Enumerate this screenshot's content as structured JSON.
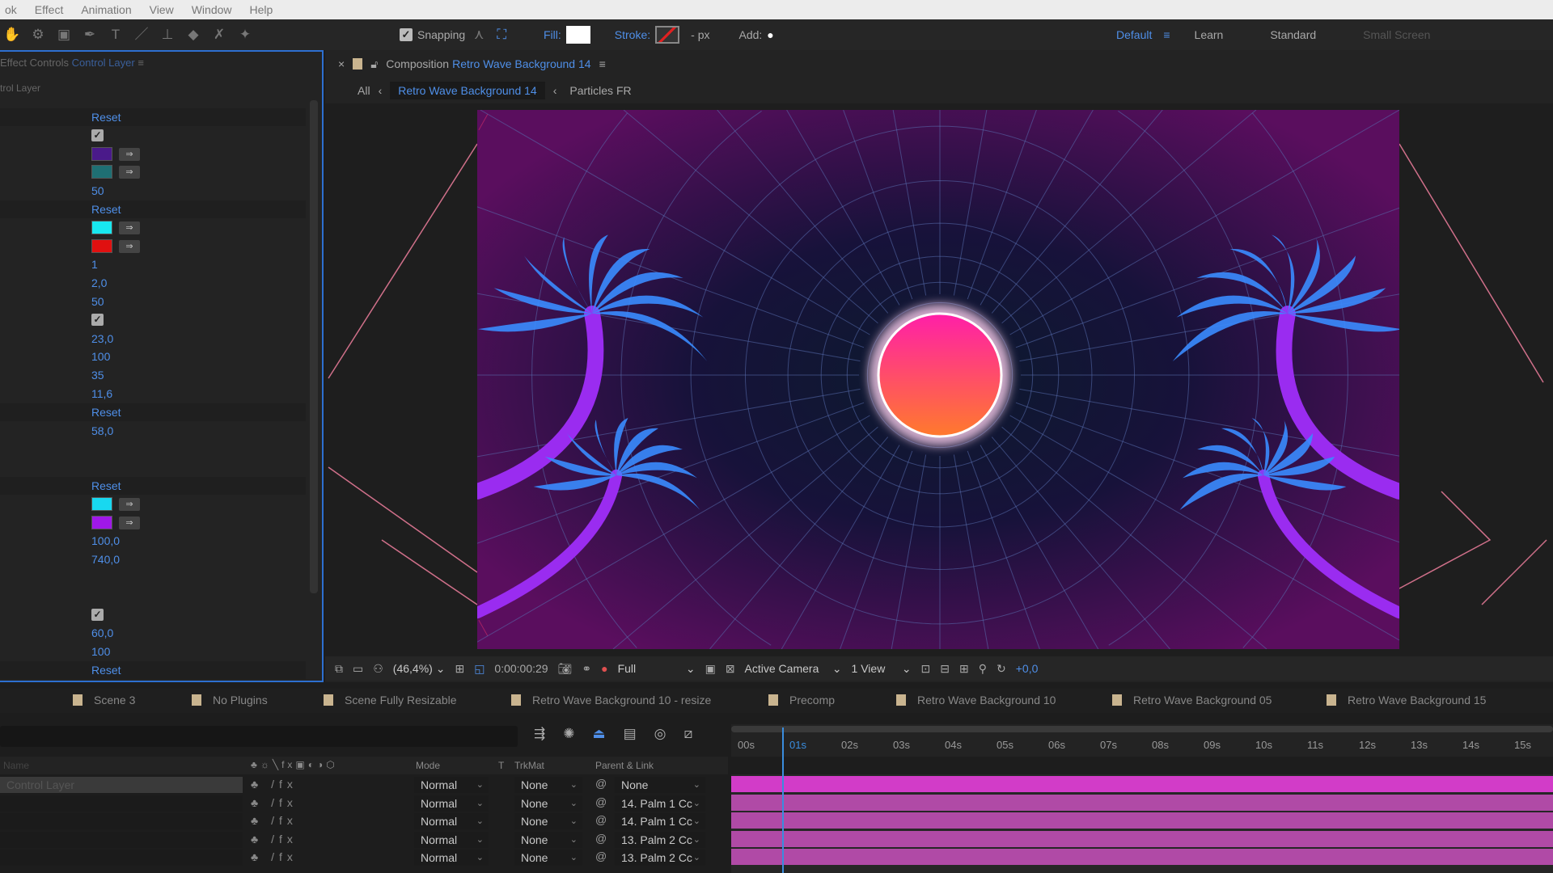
{
  "menu": [
    "ok",
    "Effect",
    "Animation",
    "View",
    "Window",
    "Help"
  ],
  "toolbar": {
    "snapping": "Snapping",
    "fill": "Fill:",
    "stroke": "Stroke:",
    "px": "- px",
    "add": "Add:",
    "workspaces": [
      "Default",
      "Learn",
      "Standard",
      "Small Screen"
    ],
    "fill_color": "#ffffff"
  },
  "left_panel": {
    "title": "Effect Controls",
    "layer": "Control Layer",
    "sublabel": "trol Layer",
    "rows": [
      {
        "t": "reset",
        "v": "Reset",
        "sec": true
      },
      {
        "t": "check"
      },
      {
        "t": "color",
        "c": "#4a1a8a"
      },
      {
        "t": "color",
        "c": "#1f6f73"
      },
      {
        "t": "val",
        "v": "50"
      },
      {
        "t": "reset",
        "v": "Reset",
        "sec": true
      },
      {
        "t": "color",
        "c": "#18e8f0"
      },
      {
        "t": "color",
        "c": "#e01010"
      },
      {
        "t": "val",
        "v": "1"
      },
      {
        "t": "val",
        "v": "2,0"
      },
      {
        "t": "val",
        "v": "50"
      },
      {
        "t": "check"
      },
      {
        "t": "val",
        "v": "23,0"
      },
      {
        "t": "val",
        "v": "100"
      },
      {
        "t": "val",
        "v": "35"
      },
      {
        "t": "val",
        "v": "11,6"
      },
      {
        "t": "reset",
        "v": "Reset",
        "sec": true
      },
      {
        "t": "val",
        "v": "58,0"
      },
      {
        "t": "gap"
      },
      {
        "t": "gap"
      },
      {
        "t": "reset",
        "v": "Reset",
        "sec": true
      },
      {
        "t": "color",
        "c": "#18d8f0"
      },
      {
        "t": "color",
        "c": "#a018e8"
      },
      {
        "t": "val",
        "v": "100,0"
      },
      {
        "t": "val",
        "v": "740,0"
      },
      {
        "t": "gap"
      },
      {
        "t": "gap"
      },
      {
        "t": "check"
      },
      {
        "t": "val",
        "v": "60,0"
      },
      {
        "t": "val",
        "v": "100"
      },
      {
        "t": "reset",
        "v": "Reset",
        "sec": true
      }
    ]
  },
  "composition": {
    "label": "Composition",
    "name": "Retro Wave Background 14",
    "tabs": {
      "all": "All",
      "active": "Retro Wave Background 14",
      "next": "Particles FR"
    }
  },
  "viewer_bar": {
    "zoom": "(46,4%)",
    "timecode": "0:00:00:29",
    "resolution": "Full",
    "camera": "Active Camera",
    "views": "1 View",
    "exposure": "+0,0"
  },
  "timeline_tabs": [
    "Scene 3",
    "No Plugins",
    "Scene Fully Resizable",
    "Retro Wave Background 10 - resize",
    "Precomp",
    "Retro Wave Background 10",
    "Retro Wave Background 05",
    "Retro Wave Background 15"
  ],
  "columns": {
    "name": "Name",
    "mode": "Mode",
    "t": "T",
    "trkmat": "TrkMat",
    "parent": "Parent & Link"
  },
  "layers": [
    {
      "name": "Control Layer",
      "mode": "Normal",
      "trkmat": "None",
      "parent": "None"
    },
    {
      "name": "",
      "mode": "Normal",
      "trkmat": "None",
      "parent": "14. Palm 1 Cc"
    },
    {
      "name": "",
      "mode": "Normal",
      "trkmat": "None",
      "parent": "14. Palm 1 Cc"
    },
    {
      "name": "",
      "mode": "Normal",
      "trkmat": "None",
      "parent": "13. Palm 2 Cc"
    },
    {
      "name": "",
      "mode": "Normal",
      "trkmat": "None",
      "parent": "13. Palm 2 Cc"
    }
  ],
  "ruler": [
    "00s",
    "01s",
    "02s",
    "03s",
    "04s",
    "05s",
    "06s",
    "07s",
    "08s",
    "09s",
    "10s",
    "11s",
    "12s",
    "13s",
    "14s",
    "15s"
  ],
  "colors": {
    "accent": "#4f8fe8",
    "layer_bar": "#b04aa6",
    "sun_top": "#ff2aa0",
    "sun_bottom": "#ff7a30",
    "palm": "#3a8cff",
    "grid": "#5a6fb0"
  }
}
